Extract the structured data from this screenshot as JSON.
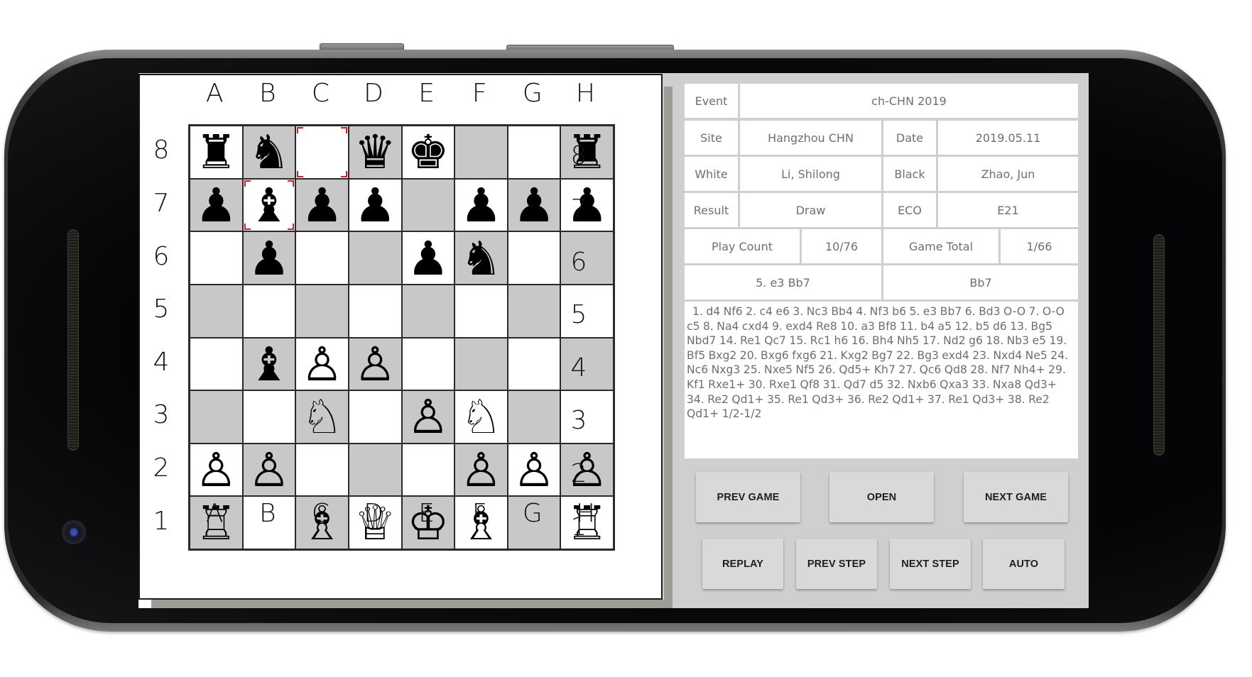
{
  "board": {
    "files": [
      "A",
      "B",
      "C",
      "D",
      "E",
      "F",
      "G",
      "H"
    ],
    "ranks": [
      "8",
      "7",
      "6",
      "5",
      "4",
      "3",
      "2",
      "1"
    ],
    "colors": {
      "light_square": "#ffffff",
      "dark_square": "#c8c8c8",
      "highlight": "#d0202a"
    },
    "position": [
      [
        "r",
        "n",
        "",
        "q",
        "k",
        "",
        "",
        "r"
      ],
      [
        "p",
        "b",
        "p",
        "p",
        "",
        "p",
        "p",
        "p"
      ],
      [
        "",
        "p",
        "",
        "",
        "p",
        "n",
        "",
        ""
      ],
      [
        "",
        "",
        "",
        "",
        "",
        "",
        "",
        ""
      ],
      [
        "",
        "b",
        "P",
        "P",
        "",
        "",
        "",
        ""
      ],
      [
        "",
        "",
        "N",
        "",
        "P",
        "N",
        "",
        ""
      ],
      [
        "P",
        "P",
        "",
        "",
        "",
        "P",
        "P",
        "P"
      ],
      [
        "R",
        "",
        "B",
        "Q",
        "K",
        "B",
        "",
        "R"
      ]
    ],
    "piece_glyphs": {
      "K": "♔",
      "Q": "♕",
      "R": "♖",
      "B": "♗",
      "N": "♘",
      "P": "♙",
      "k": "♚",
      "q": "♛",
      "r": "♜",
      "b": "♝",
      "n": "♞",
      "p": "♟"
    },
    "piece_names": {
      "K": "white-king",
      "Q": "white-queen",
      "R": "white-rook",
      "B": "white-bishop",
      "N": "white-knight",
      "P": "white-pawn",
      "k": "black-king",
      "q": "black-queen",
      "r": "black-rook",
      "b": "black-bishop",
      "n": "black-knight",
      "p": "black-pawn"
    },
    "last_move_squares": [
      "c8",
      "b7"
    ]
  },
  "game_info": {
    "event_label": "Event",
    "event_value": "ch-CHN 2019",
    "site_label": "Site",
    "site_value": "Hangzhou CHN",
    "date_label": "Date",
    "date_value": "2019.05.11",
    "white_label": "White",
    "white_value": "Li, Shilong",
    "black_label": "Black",
    "black_value": "Zhao, Jun",
    "result_label": "Result",
    "result_value": "Draw",
    "eco_label": "ECO",
    "eco_value": "E21",
    "play_count_label": "Play Count",
    "play_count_value": "10/76",
    "game_total_label": "Game Total",
    "game_total_value": "1/66",
    "current_move_full": "5. e3 Bb7",
    "current_move_san": "Bb7"
  },
  "notation": "1. d4 Nf6 2. c4 e6 3. Nc3 Bb4 4. Nf3 b6 5. e3 Bb7 6. Bd3 O-O 7. O-O c5 8. Na4 cxd4 9. exd4 Re8 10. a3 Bf8 11. b4 a5 12. b5 d6 13. Bg5 Nbd7 14. Re1 Qc7 15. Rc1 h6 16. Bh4 Nh5 17. Nd2 g6 18. Nb3 e5 19. Bf5 Bxg2 20. Bxg6 fxg6 21. Kxg2 Bg7 22. Bg3 exd4 23. Nxd4 Ne5 24. Nc6 Nxg3 25. Nxe5 Nf5 26. Qd5+ Kh7 27. Qc6 Qd8 28. Nf7 Nh4+ 29. Kf1 Rxe1+ 30. Rxe1 Qf8 31. Qd7 d5 32. Nxb6 Qxa3 33. Nxa8 Qd3+ 34. Re2 Qd1+ 35. Re1 Qd3+ 36. Re2 Qd1+ 37. Re1 Qd3+ 38. Re2 Qd1+ 1/2-1/2",
  "buttons": {
    "prev_game": "PREV GAME",
    "open": "OPEN",
    "next_game": "NEXT GAME",
    "replay": "REPLAY",
    "prev_step": "PREV STEP",
    "next_step": "NEXT STEP",
    "auto": "AUTO"
  }
}
